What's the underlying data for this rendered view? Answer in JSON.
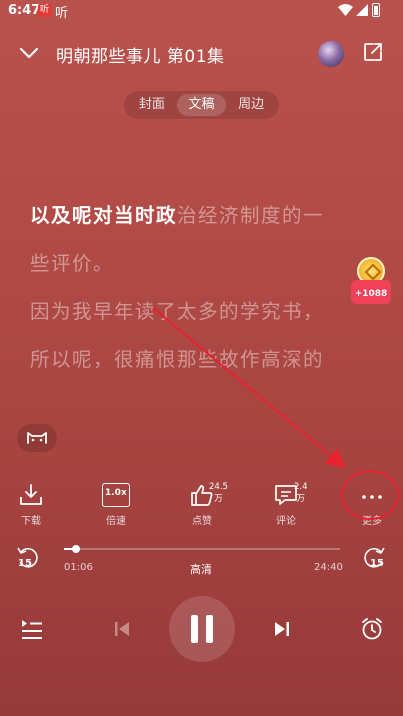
{
  "status_bar": {
    "time": "6:47",
    "app_logo_text": "听",
    "extra_icon": "听"
  },
  "header": {
    "title": "明朝那些事儿 第01集"
  },
  "tabs": [
    {
      "label": "封面",
      "active": false
    },
    {
      "label": "文稿",
      "active": true
    },
    {
      "label": "周边",
      "active": false
    }
  ],
  "transcript": {
    "line1_highlight": "以及呢对当时政",
    "line1_rest": "治经济制度的一",
    "line2": "些评价。",
    "line3": "因为我早年读了太多的学究书，",
    "line4": "所以呢，很痛恨那些故作高深的"
  },
  "coupon": {
    "label": "+1088"
  },
  "actions": {
    "download": {
      "label": "下载"
    },
    "speed": {
      "label": "倍速",
      "badge": "1.0x"
    },
    "like": {
      "label": "点赞",
      "count": "24.5万"
    },
    "comment": {
      "label": "评论",
      "count": "2.4万"
    },
    "more": {
      "label": "更多"
    }
  },
  "player": {
    "current_time": "01:06",
    "total_time": "24:40",
    "quality": "高清",
    "skip_back": "15",
    "skip_forward": "15",
    "progress_fraction": 0.045
  },
  "colors": {
    "background_top": "#b9524d",
    "background_bottom": "#96393a",
    "annotation_red": "#e8222e",
    "coupon_red": "#f0405a"
  }
}
